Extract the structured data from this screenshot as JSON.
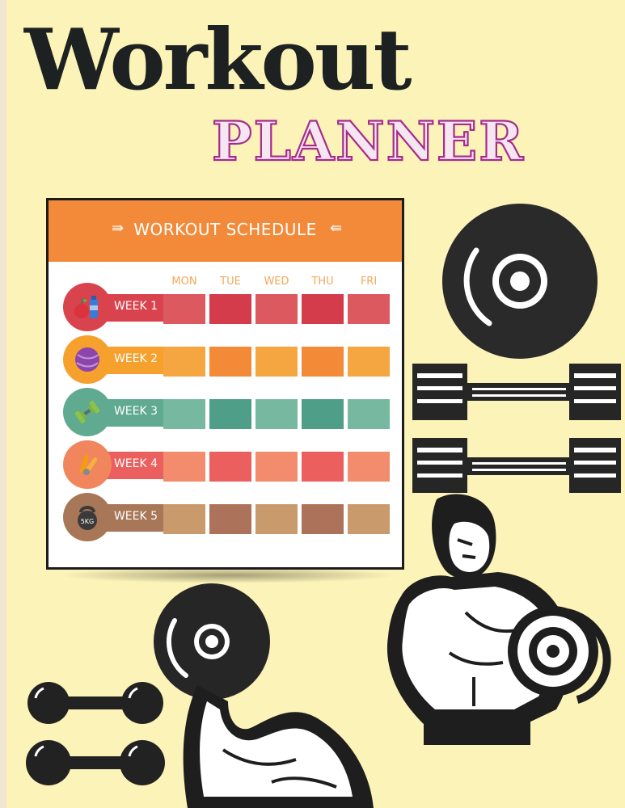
{
  "cover": {
    "title": "Workout",
    "subtitle": "PLANNER"
  },
  "schedule": {
    "title": "WORKOUT SCHEDULE",
    "header_color": "#f28a3a",
    "days": [
      "MON",
      "TUE",
      "WED",
      "THU",
      "FRI"
    ],
    "weeks": [
      {
        "label": "WEEK 1",
        "icon": "apple-bottle-icon",
        "circle": "#d9434e",
        "ribbon": "#d9434e",
        "cells": [
          "#dc5a5f",
          "#d43c4c",
          "#dc5a5f",
          "#d43c4c",
          "#dc5a5f"
        ]
      },
      {
        "label": "WEEK 2",
        "icon": "exercise-ball-icon",
        "circle": "#f6a02e",
        "ribbon": "#f6a02e",
        "cells": [
          "#f6a640",
          "#f28a38",
          "#f6a640",
          "#f28a38",
          "#f6a640"
        ]
      },
      {
        "label": "WEEK 3",
        "icon": "dumbbell-icon",
        "circle": "#5faa90",
        "ribbon": "#5faa90",
        "cells": [
          "#76b9a0",
          "#4f9e87",
          "#76b9a0",
          "#4f9e87",
          "#76b9a0"
        ]
      },
      {
        "label": "WEEK 4",
        "icon": "hand-grip-icon",
        "circle": "#f0855e",
        "ribbon": "#ec5f5f",
        "cells": [
          "#f28c6c",
          "#ec5f5f",
          "#f28c6c",
          "#ec5f5f",
          "#f28c6c"
        ]
      },
      {
        "label": "WEEK 5",
        "icon": "kettlebell-icon",
        "circle": "#a87758",
        "ribbon": "#a87758",
        "cells": [
          "#c89a6c",
          "#ad735a",
          "#c89a6c",
          "#ad735a",
          "#c89a6c"
        ]
      }
    ],
    "kettlebell_text": "5KG"
  }
}
